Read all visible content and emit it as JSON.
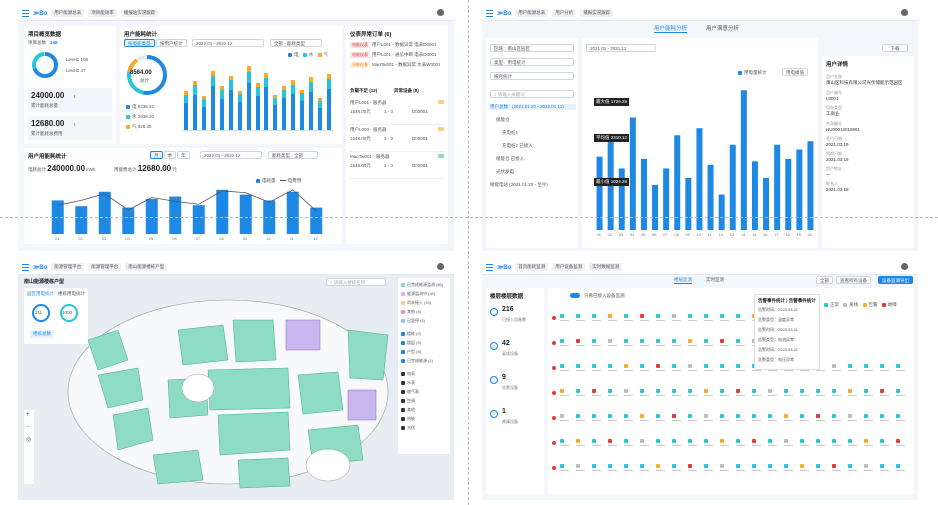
{
  "tl": {
    "bc1": "用户能源总表",
    "bc2": "项目能效率",
    "bc3": "播报站实况跟踪",
    "card1_title": "项目概览数据",
    "total_label": "项目总数",
    "total_value": "168",
    "legend1": "Level1  108",
    "legend2": "Level2  47",
    "kpi1_value": "24000.00",
    "kpi1_unit": "t",
    "kpi1_label": "累计能耗总量",
    "kpi2_value": "12680.00",
    "kpi2_unit": "t",
    "kpi2_label": "累计能耗总费用",
    "card2_title": "用户能耗统计",
    "pill1": "按电能类型",
    "pill2": "按用户统计",
    "date_range": "2022.01 - 2022.12",
    "select_label": "全部 · 能耗类型",
    "donut_value": "8564.00",
    "donut_unit": "总计",
    "d_leg1": "电  5236.32",
    "d_leg2": "水  1938.20",
    "d_leg3": "气  928.40",
    "legend_a": "电",
    "legend_b": "水",
    "legend_c": "气",
    "card3_title": "仪表异常订单",
    "alarm_count": "6",
    "alarms": [
      {
        "tag": "电能仪表",
        "text": "用户L001 - 数据异常 电表D0001"
      },
      {
        "tag": "电能仪表",
        "text": "用户L001 - 通信中断 电表D0001"
      },
      {
        "tag": "水能仪表",
        "text": "MaoTai001 - 数据异常 水表W0001"
      }
    ],
    "tab_a": "负载不足 (12)",
    "tab_b": "异常设备 (8)",
    "rows": [
      {
        "name": "用户L001 - 服务器",
        "v1": "1548.00元",
        "v2": "1 - 3",
        "code": "D00001"
      },
      {
        "name": "用户L003 - 服务器",
        "v1": "1548.00元",
        "v2": "1 - 3",
        "code": "D00001"
      },
      {
        "name": "MaoTai001 - 服务器",
        "v1": "1548.00元",
        "v2": "1 - 3",
        "code": "D00001"
      }
    ],
    "card4_title": "用户用能耗统计",
    "seg": [
      "月",
      "季",
      "年"
    ],
    "date2": "2022.01 - 2022.12",
    "select2": "能耗类型 - 全部",
    "sum1_label": "电耗总计",
    "sum1_value": "240000.00",
    "sum1_unit": "kWh",
    "sum2_label": "用能费总计",
    "sum2_value": "12680.00",
    "sum2_unit": "元",
    "legend_bar": "电耗量",
    "legend_line": "电费用"
  },
  "tr": {
    "bc1": "用户能源总表",
    "bc2": "用户分析",
    "bc3": "播报实况跟踪",
    "tab1": "用户能耗分析",
    "tab2": "用户满意分析",
    "f1": "区域：南山区园区",
    "f2": "类型：用电统计",
    "f3": "按月统计",
    "search": "请输入关键词",
    "date": "2021.01 - 2021.12",
    "download": "下载",
    "tree": [
      "用户总数 · (2021.01.20 - 2022.01.11)",
      "储能仓",
      "充电桩1",
      "充电桩2 已接入",
      "储能仓 已接入",
      "光伏发电",
      "储能电站 (2021.01.20 - 至今)"
    ],
    "chart_legend_a": "用电量统计",
    "chart_legend_b": "用电峰值",
    "tips": [
      "最大值 1726.28",
      "平均值 2310.12",
      "最小值 1024.28"
    ],
    "detail_title": "用户详情",
    "detail": [
      {
        "k": "用户名称",
        "v": "南山区科技有限公司光伏储能示范园区"
      },
      {
        "k": "用户编号",
        "v": "L0001"
      },
      {
        "k": "用电类型",
        "v": "工商业"
      },
      {
        "k": "合同编号",
        "v": "HU00014018891"
      },
      {
        "k": "签约日期",
        "v": "2021.03.19"
      },
      {
        "k": "到期日期",
        "v": "2021.03.19"
      },
      {
        "k": "用户地址",
        "v": "—"
      },
      {
        "k": "联系人",
        "v": "2021.03.19"
      }
    ]
  },
  "bl": {
    "bc1": "能源管理平台",
    "bc2": "能源管理平台",
    "bc3": "南山能源楼栋户型",
    "panel_title": "南山能源楼栋户型",
    "tab1": "园区用电统计",
    "tab2": "楼栋用电统计",
    "c1_value": "211",
    "c2_value": "1000",
    "stat_label": "楼栋总数",
    "search": "请输入楼栋名称",
    "legend": [
      "已完成能源监测 (80)",
      "能源监测中 (40)",
      "尚未接入 (20)",
      "其他 (8)",
      "已暂停 (4)"
    ],
    "legend2": [
      "楼栋 (2)",
      "楼层 (5)",
      "户型 (8)",
      "已完成能源 (1)"
    ],
    "legend3": [
      "电表",
      "水表",
      "燃气表",
      "空调",
      "其他",
      "热能",
      "光伏"
    ]
  },
  "br": {
    "bc1": "首页能耗监测",
    "bc2": "用户设备监测",
    "bc3": "实时数据监测",
    "tab1": "楼层监测",
    "tab2": "实时监测",
    "btn_a": "全部",
    "btn_b": "查看所有设备",
    "btn_c": "设备监测导出",
    "panel_title": "楼层楼层数据",
    "stats": [
      {
        "v": "216",
        "l": "已接入设备数"
      },
      {
        "v": "42",
        "l": "离线设备"
      },
      {
        "v": "9",
        "l": "告警设备"
      },
      {
        "v": "1",
        "l": "故障设备"
      }
    ],
    "toggle_label": "只看已接入设备监测",
    "legend": [
      "正常",
      "离线",
      "告警",
      "故障"
    ],
    "popup_title": "告警事件统计 | 告警事件统计",
    "popup_rows": [
      "告警时间：2023.03.21",
      "告警类型：温度异常",
      "告警时间：2023.03.21",
      "告警类型：电流异常",
      "告警时间：2023.03.21",
      "告警类型：电压异常"
    ]
  },
  "chart_data": [
    {
      "type": "bar",
      "series": [
        {
          "name": "电",
          "values": [
            55,
            72,
            48,
            90,
            63,
            82,
            58,
            96,
            70,
            88,
            52,
            66,
            74,
            60,
            78,
            46,
            84
          ]
        },
        {
          "name": "水",
          "values": [
            18,
            20,
            15,
            22,
            19,
            21,
            16,
            24,
            18,
            20,
            14,
            17,
            19,
            16,
            21,
            13,
            22
          ]
        },
        {
          "name": "气",
          "values": [
            8,
            9,
            7,
            10,
            8,
            9,
            7,
            11,
            8,
            9,
            6,
            8,
            9,
            7,
            10,
            6,
            10
          ]
        }
      ],
      "xlabel": "",
      "ylabel": ""
    },
    {
      "type": "bar",
      "categories": [
        "01",
        "02",
        "03",
        "04",
        "05",
        "06",
        "07",
        "08",
        "09",
        "10",
        "11",
        "12"
      ],
      "series": [
        {
          "name": "电耗量",
          "values": [
            70,
            58,
            88,
            55,
            73,
            78,
            60,
            92,
            82,
            70,
            88,
            55
          ]
        },
        {
          "name": "电费用",
          "values": [
            60,
            70,
            84,
            50,
            76,
            68,
            62,
            90,
            86,
            66,
            92,
            48
          ]
        }
      ],
      "xlabel": "",
      "ylabel": ""
    },
    {
      "type": "bar",
      "categories": [
        "01",
        "02",
        "03",
        "04",
        "05",
        "06",
        "07",
        "08",
        "09",
        "10",
        "11",
        "12",
        "13",
        "14",
        "15",
        "16",
        "17",
        "18",
        "19",
        "20"
      ],
      "series": [
        {
          "name": "用电量统计",
          "values": [
            62,
            78,
            52,
            95,
            60,
            38,
            52,
            80,
            44,
            86,
            55,
            30,
            72,
            118,
            58,
            44,
            72,
            60,
            68,
            75
          ]
        }
      ],
      "xlabel": "",
      "ylabel": ""
    }
  ]
}
